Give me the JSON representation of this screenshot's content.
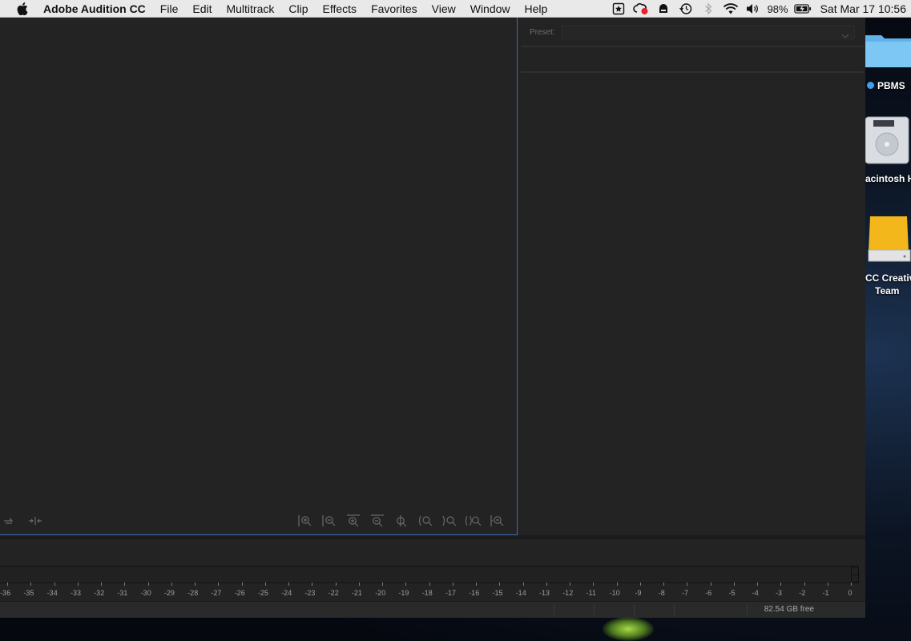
{
  "menubar": {
    "app_name": "Adobe Audition CC",
    "items": [
      "File",
      "Edit",
      "Multitrack",
      "Clip",
      "Effects",
      "Favorites",
      "View",
      "Window",
      "Help"
    ],
    "battery": "98%",
    "clock": "Sat Mar 17  10:56"
  },
  "effects": {
    "preset_label": "Preset:",
    "preset_value": ""
  },
  "levels": {
    "scale": [
      "-36",
      "-35",
      "-34",
      "-33",
      "-32",
      "-31",
      "-30",
      "-29",
      "-28",
      "-27",
      "-26",
      "-25",
      "-24",
      "-23",
      "-22",
      "-21",
      "-20",
      "-19",
      "-18",
      "-17",
      "-16",
      "-15",
      "-14",
      "-13",
      "-12",
      "-11",
      "-10",
      "-9",
      "-8",
      "-7",
      "-6",
      "-5",
      "-4",
      "-3",
      "-2",
      "-1",
      "0"
    ]
  },
  "statusbar": {
    "free_space": "82.54 GB free"
  },
  "desktop": {
    "items": [
      {
        "label": "PBMS",
        "icon": "folder-icon",
        "tag_color": "#3aa0f0"
      },
      {
        "label": "acintosh H",
        "icon": "hard-drive-icon"
      },
      {
        "label_line1": "CC Creativ",
        "label_line2": "Team",
        "icon": "external-drive-icon"
      }
    ]
  },
  "colors": {
    "accent_border": "#3b6fb8",
    "panel_bg": "#232323",
    "menubar_bg": "#e9e9e9"
  }
}
